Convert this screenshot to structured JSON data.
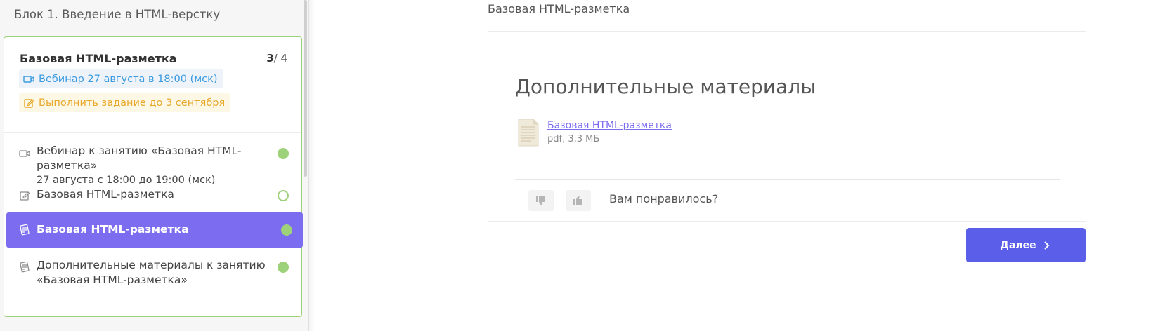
{
  "sidebar": {
    "block_title": "Блок 1. Введение в HTML-верстку",
    "lesson": {
      "title": "Базовая HTML-разметка",
      "progress_current": "3",
      "progress_total": "/ 4",
      "webinar_tag": "Вебинар 27 августа в 18:00 (мск)",
      "task_tag": "Выполнить задание до 3 сентября"
    },
    "items": [
      {
        "label": "Вебинар к занятию «Базовая HTML-разметка»",
        "sublabel": "27 августа с 18:00 до 19:00 (мск)",
        "icon": "video-camera-icon",
        "status": "done"
      },
      {
        "label": "Базовая HTML-разметка",
        "icon": "edit-icon",
        "status": "pending"
      },
      {
        "label": "Базовая HTML-разметка",
        "icon": "materials-icon",
        "status": "done",
        "active": true
      },
      {
        "label": "Дополнительные материалы к занятию",
        "sublabel": "«Базовая HTML-разметка»",
        "icon": "materials-icon",
        "status": "done"
      }
    ]
  },
  "main": {
    "breadcrumb": "Базовая HTML-разметка",
    "panel_title": "Дополнительные материалы",
    "file": {
      "name": "Базовая HTML-разметка",
      "meta": "pdf, 3,3 МБ",
      "icon": "document-icon"
    },
    "feedback_question": "Вам понравилось?",
    "next_label": "Далее"
  },
  "colors": {
    "accent": "#7b6cf0",
    "button": "#5b5ee9",
    "success": "#9ed27a",
    "webinar": "#3a9be0",
    "task": "#e8a92a"
  }
}
